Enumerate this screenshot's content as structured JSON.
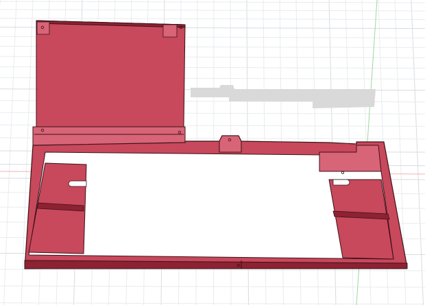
{
  "viewport": {
    "kind": "3d-cad-viewport",
    "background": "#ffffff",
    "grid_color": "#d7dbe0",
    "grid_minor_color": "#e8ebee",
    "axis_x_color": "#f0b4b4",
    "axis_y_color": "#9fd69f"
  },
  "model": {
    "body_color": "#c8485c",
    "body_light": "#d86478",
    "body_dark": "#8c2232",
    "edge_color": "#3a1218",
    "shadow_color": "#d9d9d9"
  }
}
